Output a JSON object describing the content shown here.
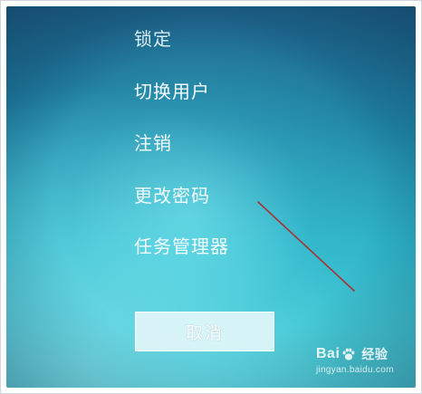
{
  "menu": {
    "items": [
      {
        "label": "锁定"
      },
      {
        "label": "切换用户"
      },
      {
        "label": "注销"
      },
      {
        "label": "更改密码"
      },
      {
        "label": "任务管理器"
      }
    ],
    "cancel_label": "取消"
  },
  "watermark": {
    "brand_prefix": "Bai",
    "brand_suffix": "经验",
    "url": "jingyan.baidu.com"
  },
  "colors": {
    "background_top": "#1d5f86",
    "background_bottom": "#52cfd8",
    "menu_text": "#f4fbfd",
    "annotation_line": "#a83232"
  }
}
